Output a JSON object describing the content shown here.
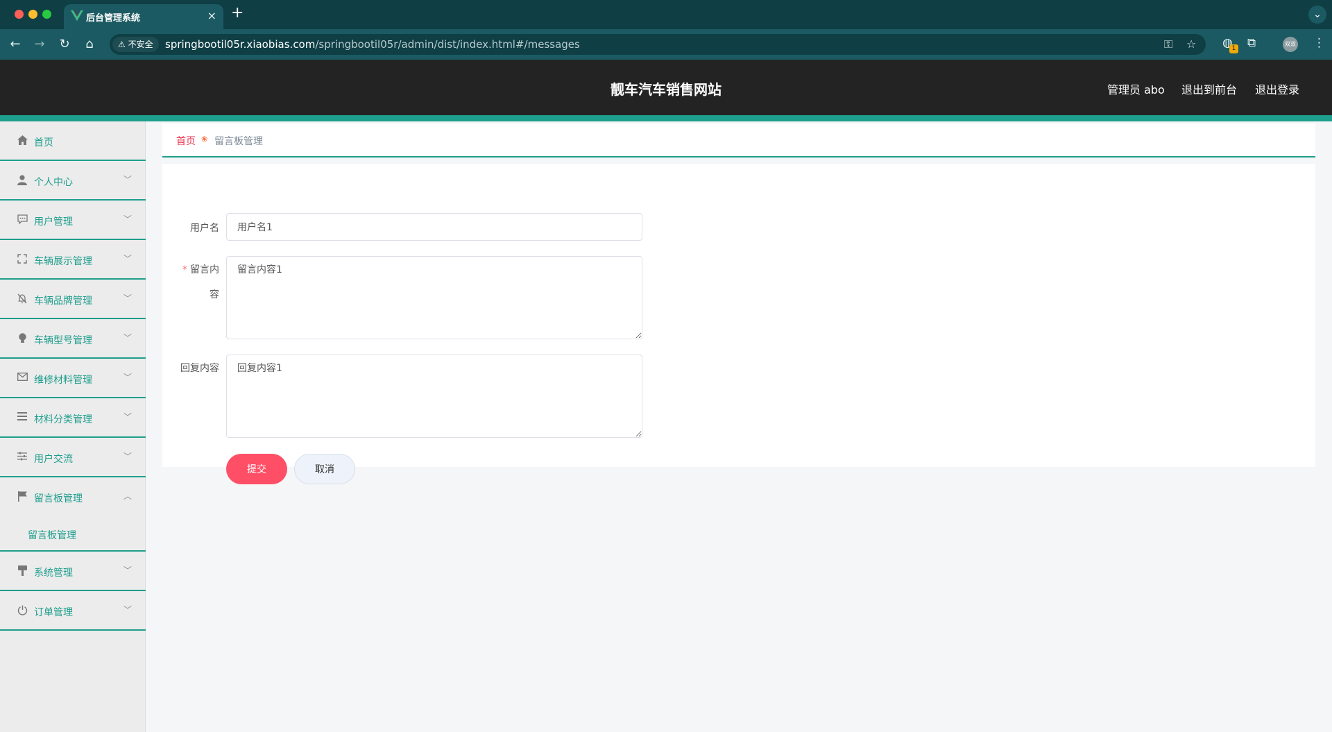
{
  "browser": {
    "tab_title": "后台管理系统",
    "tab_close": "×",
    "new_tab": "+",
    "tab_menu_icon": "⌄",
    "security_label": "不安全",
    "url_host": "springbootil05r.xiaobias.com",
    "url_path": "/springbootil05r/admin/dist/index.html#/messages",
    "extension_badge": "1",
    "profile_label": "双双"
  },
  "header": {
    "site_title": "靓车汽车销售网站",
    "admin_label": "管理员 abo",
    "front_link": "退出到前台",
    "logout_link": "退出登录"
  },
  "sidebar": {
    "home": {
      "label": "首页",
      "icon": "home-icon"
    },
    "items": [
      {
        "label": "个人中心",
        "icon": "user-icon"
      },
      {
        "label": "用户管理",
        "icon": "chat-icon"
      },
      {
        "label": "车辆展示管理",
        "icon": "fullscreen-icon"
      },
      {
        "label": "车辆品牌管理",
        "icon": "bell-off-icon"
      },
      {
        "label": "车辆型号管理",
        "icon": "bulb-icon"
      },
      {
        "label": "维修材料管理",
        "icon": "mail-icon"
      },
      {
        "label": "材料分类管理",
        "icon": "list-icon"
      },
      {
        "label": "用户交流",
        "icon": "sliders-icon"
      },
      {
        "label": "留言板管理",
        "icon": "flag-icon",
        "expanded": true
      },
      {
        "label": "系统管理",
        "icon": "brush-icon"
      },
      {
        "label": "订单管理",
        "icon": "power-icon"
      }
    ],
    "submenu": {
      "label": "留言板管理"
    }
  },
  "breadcrumb": {
    "home": "首页",
    "current": "留言板管理"
  },
  "form": {
    "username_label": "用户名",
    "username_value": "用户名1",
    "content_label_line1": "留言内",
    "content_label_line2": "容",
    "content_value": "留言内容1",
    "content_required": "*",
    "reply_label": "回复内容",
    "reply_value": "回复内容1",
    "submit_label": "提交",
    "cancel_label": "取消"
  },
  "colors": {
    "accent": "#1e9e8c",
    "header_bg": "#232323",
    "submit": "#ff4f66",
    "breadcrumb_home": "#e8344e"
  }
}
